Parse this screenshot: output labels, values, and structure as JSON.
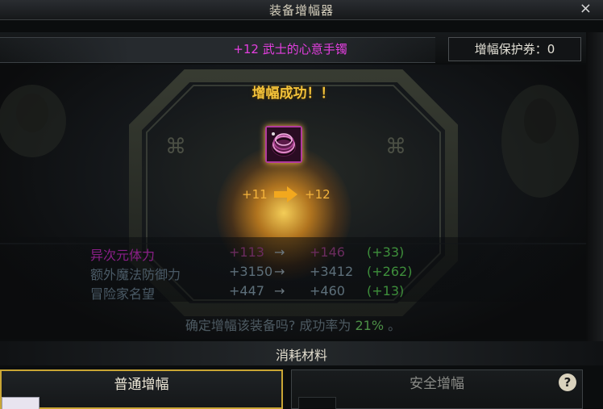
{
  "window": {
    "title": "装备增幅器",
    "close_glyph": "×"
  },
  "item": {
    "name": "+12 武士的心意手镯",
    "rarity_color": "#e43fe0"
  },
  "protect": {
    "label": "增幅保护券：0"
  },
  "result": {
    "success_text": "增幅成功！！",
    "from_level": "+11",
    "to_level": "+12",
    "item_icon": "bracelet-icon"
  },
  "stats": [
    {
      "name": "异次元体力",
      "before": "+113",
      "arrow": "→",
      "after": "+146",
      "diff": "(+33)",
      "color": "#8a1f87"
    },
    {
      "name": "额外魔法防御力",
      "before": "+3150",
      "arrow": "→",
      "after": "+3412",
      "diff": "(+262)",
      "color": "#4a5a66"
    },
    {
      "name": "冒险家名望",
      "before": "+447",
      "arrow": "→",
      "after": "+460",
      "diff": "(+13)",
      "color": "#4a5a66"
    }
  ],
  "confirm": {
    "text": "确定增幅该装备吗? 成功率为",
    "rate": "21%",
    "suffix": "。"
  },
  "materials": {
    "title": "消耗材料"
  },
  "tabs": {
    "normal": "普通增幅",
    "safe": "安全增幅",
    "help_glyph": "?"
  },
  "colors": {
    "accent_gold": "#c9a534",
    "success": "#f4c33a",
    "level": "#f3b33c",
    "stat_gain": "#3e8f3b"
  }
}
